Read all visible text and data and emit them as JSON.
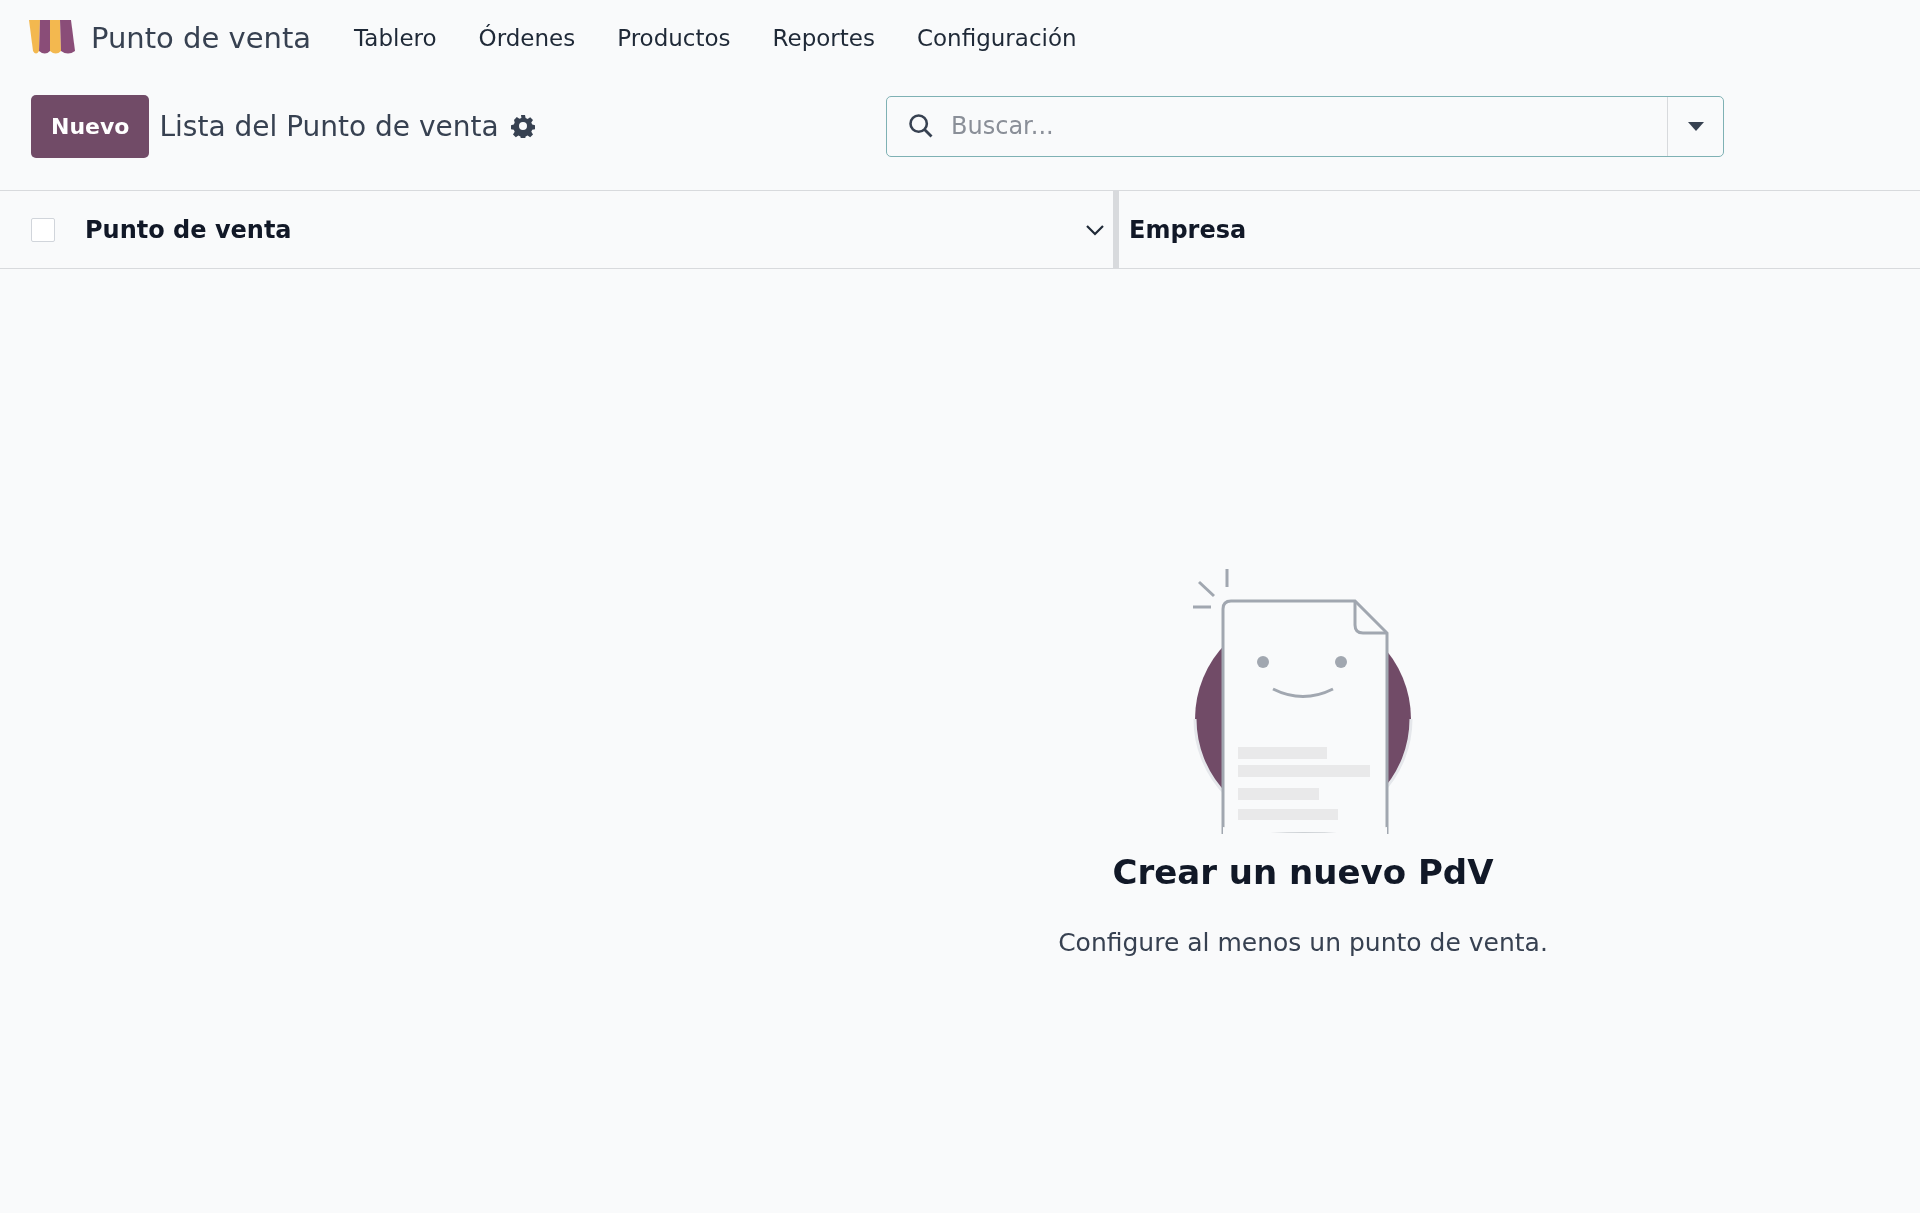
{
  "app": {
    "name": "Punto de venta",
    "menu": [
      {
        "label": "Tablero"
      },
      {
        "label": "Órdenes"
      },
      {
        "label": "Productos"
      },
      {
        "label": "Reportes"
      },
      {
        "label": "Configuración"
      }
    ]
  },
  "control_panel": {
    "new_button": "Nuevo",
    "title": "Lista del Punto de venta",
    "search": {
      "placeholder": "Buscar..."
    }
  },
  "table": {
    "select_all": {
      "checked": false
    },
    "columns": [
      {
        "label": "Punto de venta",
        "kind": "sortable"
      },
      {
        "label": "Empresa",
        "kind": "plain"
      }
    ]
  },
  "empty_state": {
    "title": "Crear un nuevo PdV",
    "message": "Configure al menos un punto de venta."
  }
}
